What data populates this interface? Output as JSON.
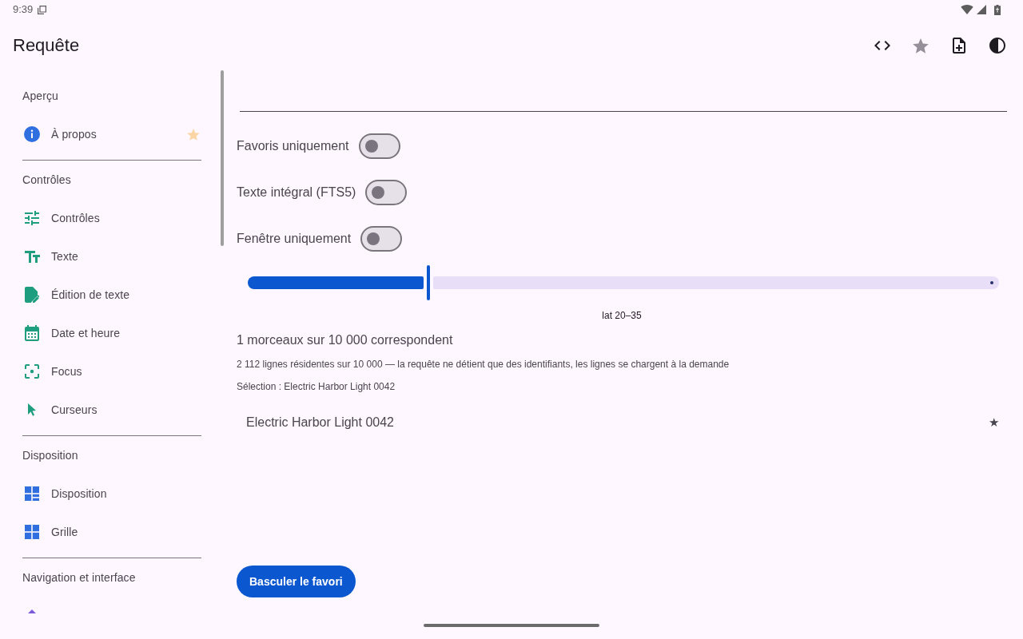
{
  "status_bar": {
    "time": "9:39"
  },
  "app_bar": {
    "title": "Requête"
  },
  "sidebar": {
    "sections": [
      {
        "title": "Aperçu",
        "items": [
          {
            "label": "À propos",
            "favorite": true
          }
        ]
      },
      {
        "title": "Contrôles",
        "items": [
          {
            "label": "Contrôles",
            "favorite": false
          },
          {
            "label": "Texte",
            "favorite": false
          },
          {
            "label": "Édition de texte",
            "favorite": false
          },
          {
            "label": "Date et heure",
            "favorite": false
          },
          {
            "label": "Focus",
            "favorite": false
          },
          {
            "label": "Curseurs",
            "favorite": false
          }
        ]
      },
      {
        "title": "Disposition",
        "items": [
          {
            "label": "Disposition",
            "favorite": false
          },
          {
            "label": "Grille",
            "favorite": false
          }
        ]
      },
      {
        "title": "Navigation et interface",
        "items": [
          {
            "favorite": false
          }
        ]
      }
    ]
  },
  "filters": [
    {
      "label": "Favoris uniquement",
      "on": false
    },
    {
      "label": "Texte intégral (FTS5)",
      "on": false
    },
    {
      "label": "Fenêtre uniquement",
      "on": false
    }
  ],
  "slider": {
    "level": 0.24,
    "label": "lat 20–35"
  },
  "match_count": "1 morceaux sur 10 000 correspondent",
  "residency_note": "2 112 lignes résidentes sur 10 000 — la requête ne détient que des identifiants, les lignes se chargent à la demande",
  "selection": "Sélection : Electric Harbor Light 0042",
  "results": [
    {
      "title": "Electric Harbor Light 0042",
      "mark": "★"
    }
  ],
  "action_button": "Basculer le favori"
}
